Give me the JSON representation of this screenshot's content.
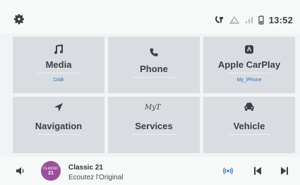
{
  "status": {
    "time": "13:52"
  },
  "tiles": [
    {
      "label": "Media",
      "sub": "DAB",
      "icon": "music-note-icon"
    },
    {
      "label": "Phone",
      "sub": "",
      "icon": "phone-icon"
    },
    {
      "label": "Apple CarPlay",
      "sub": "My_iPhone",
      "icon": "carplay-icon"
    },
    {
      "label": "Navigation",
      "sub": "",
      "icon": "navigation-arrow-icon"
    },
    {
      "label": "Services",
      "sub": "",
      "icon": "services-logo-icon"
    },
    {
      "label": "Vehicle",
      "sub": "",
      "icon": "car-icon"
    }
  ],
  "services_logo_text": "MyT",
  "media": {
    "station_logo_top": "CLASSIC",
    "station_logo_bottom": "21",
    "station_name": "Classic 21",
    "station_slogan": "Ecoutez l'Original"
  },
  "colors": {
    "accent": "#2e6fb8",
    "tile": "#d9dde1",
    "background": "#f2f3f4",
    "station_logo": "#9b4f9a"
  }
}
